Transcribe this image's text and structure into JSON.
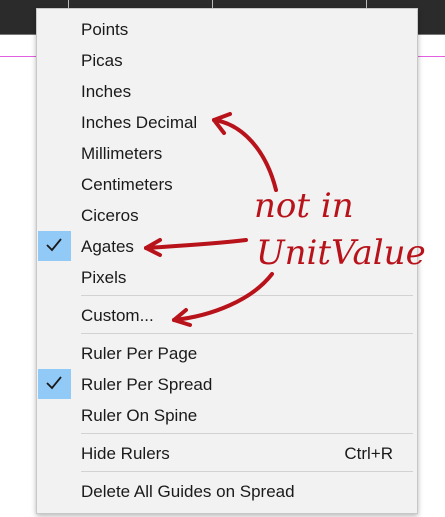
{
  "menu": {
    "items": [
      {
        "label": "Points"
      },
      {
        "label": "Picas"
      },
      {
        "label": "Inches"
      },
      {
        "label": "Inches Decimal"
      },
      {
        "label": "Millimeters"
      },
      {
        "label": "Centimeters"
      },
      {
        "label": "Ciceros"
      },
      {
        "label": "Agates",
        "checked": true
      },
      {
        "label": "Pixels"
      },
      {
        "label": "Custom..."
      },
      {
        "label": "Ruler Per Page"
      },
      {
        "label": "Ruler Per Spread",
        "checked": true
      },
      {
        "label": "Ruler On Spine"
      },
      {
        "label": "Hide Rulers",
        "shortcut": "Ctrl+R"
      },
      {
        "label": "Delete All Guides on Spread"
      }
    ]
  },
  "annotation": {
    "line1": "not in",
    "line2": "UnitValue"
  },
  "colors": {
    "menu_bg": "#f2f2f2",
    "check_highlight": "#91c9f7",
    "annotation_red": "#b8121b",
    "guide_magenta": "#e25fe2"
  }
}
